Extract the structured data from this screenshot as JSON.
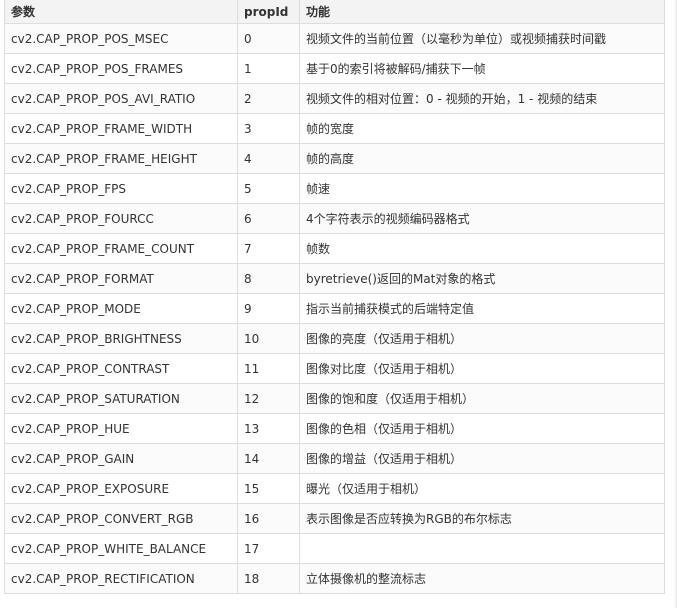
{
  "table": {
    "headers": [
      "参数",
      "propId",
      "功能"
    ],
    "rows": [
      [
        "cv2.CAP_PROP_POS_MSEC",
        "0",
        "视频文件的当前位置（以毫秒为单位）或视频捕获时间戳"
      ],
      [
        "cv2.CAP_PROP_POS_FRAMES",
        "1",
        "基于0的索引将被解码/捕获下一帧"
      ],
      [
        "cv2.CAP_PROP_POS_AVI_RATIO",
        "2",
        "视频文件的相对位置：0 - 视频的开始，1 - 视频的结束"
      ],
      [
        "cv2.CAP_PROP_FRAME_WIDTH",
        "3",
        "帧的宽度"
      ],
      [
        "cv2.CAP_PROP_FRAME_HEIGHT",
        "4",
        "帧的高度"
      ],
      [
        "cv2.CAP_PROP_FPS",
        "5",
        "帧速"
      ],
      [
        "cv2.CAP_PROP_FOURCC",
        "6",
        "4个字符表示的视频编码器格式"
      ],
      [
        "cv2.CAP_PROP_FRAME_COUNT",
        "7",
        "帧数"
      ],
      [
        "cv2.CAP_PROP_FORMAT",
        "8",
        "byretrieve()返回的Mat对象的格式"
      ],
      [
        "cv2.CAP_PROP_MODE",
        "9",
        "指示当前捕获模式的后端特定值"
      ],
      [
        "cv2.CAP_PROP_BRIGHTNESS",
        "10",
        "图像的亮度（仅适用于相机）"
      ],
      [
        "cv2.CAP_PROP_CONTRAST",
        "11",
        "图像对比度（仅适用于相机）"
      ],
      [
        "cv2.CAP_PROP_SATURATION",
        "12",
        "图像的饱和度（仅适用于相机）"
      ],
      [
        "cv2.CAP_PROP_HUE",
        "13",
        "图像的色相（仅适用于相机）"
      ],
      [
        "cv2.CAP_PROP_GAIN",
        "14",
        "图像的增益（仅适用于相机）"
      ],
      [
        "cv2.CAP_PROP_EXPOSURE",
        "15",
        "曝光（仅适用于相机）"
      ],
      [
        "cv2.CAP_PROP_CONVERT_RGB",
        "16",
        "表示图像是否应转换为RGB的布尔标志"
      ],
      [
        "cv2.CAP_PROP_WHITE_BALANCE",
        "17",
        ""
      ],
      [
        "cv2.CAP_PROP_RECTIFICATION",
        "18",
        "立体摄像机的整流标志"
      ]
    ]
  }
}
